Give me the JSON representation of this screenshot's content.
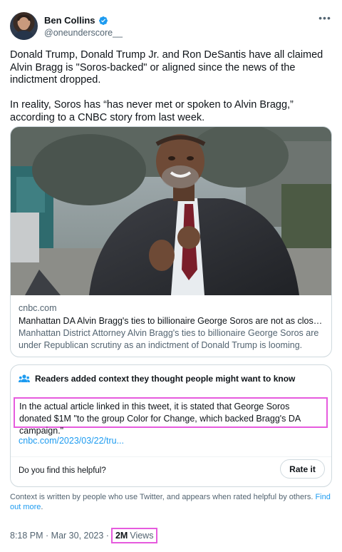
{
  "author": {
    "name": "Ben Collins",
    "handle": "@oneunderscore__",
    "verified_color": "#1d9bf0",
    "avatar_icon": "user-avatar"
  },
  "tweet": {
    "paragraphs": [
      "Donald Trump, Donald Trump Jr. and Ron DeSantis have all claimed Alvin Bragg is \"Soros-backed\" or aligned since the news of the indictment dropped.",
      "In reality, Soros has “has never met or spoken to Alvin Bragg,” according to a CNBC story from last week."
    ]
  },
  "link_card": {
    "domain": "cnbc.com",
    "title": "Manhattan DA Alvin Bragg's ties to billionaire George Soros are not as close a...",
    "description": "Manhattan District Attorney Alvin Bragg's ties to billionaire George Soros are under Republican scrutiny as an indictment of Donald Trump is looming."
  },
  "community_note": {
    "header": "Readers added context they thought people might want to know",
    "body": "In the actual article linked in this tweet, it is stated that George Soros donated $1M \"to the group Color for Change, which backed Bragg's DA campaign.\"",
    "link": "cnbc.com/2023/03/22/tru...",
    "helpful_question": "Do you find this helpful?",
    "rate_label": "Rate it",
    "highlight_color": "#e65bde"
  },
  "context_footer": {
    "text": "Context is written by people who use Twitter, and appears when rated helpful by others.",
    "link": "Find out more",
    "suffix": "."
  },
  "meta": {
    "timestamp": "8:18 PM · Mar 30, 2023 ·",
    "views_count": "2M",
    "views_label": "Views"
  },
  "colors": {
    "text": "#0f1419",
    "secondary": "#536471",
    "link": "#1d9bf0",
    "border": "#cfd9de"
  }
}
